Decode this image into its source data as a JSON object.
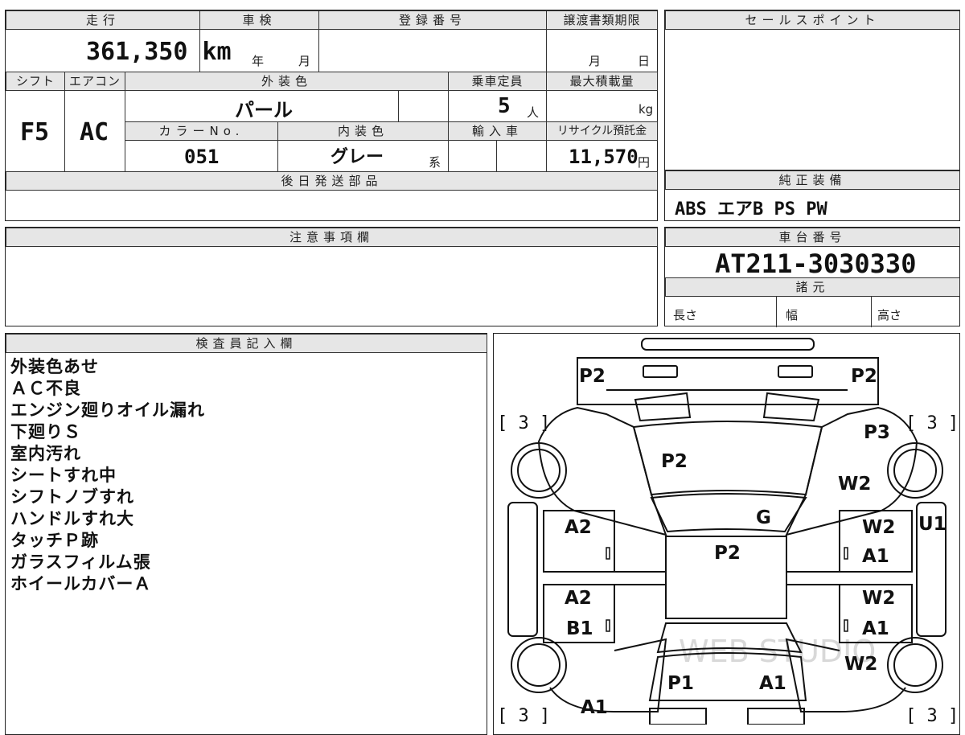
{
  "top_block": {
    "mileage_label": "走行",
    "mileage_value": "361,350 km",
    "inspection_label": "車検",
    "inspection_year": "年",
    "inspection_month": "月",
    "registration_label": "登録番号",
    "deadline_label": "譲渡書類期限",
    "deadline_month": "月",
    "deadline_day": "日",
    "shift_label": "シフト",
    "shift_value": "F5",
    "ac_label": "エアコン",
    "ac_value": "AC",
    "exterior_label": "外装色",
    "exterior_value": "パール",
    "capacity_label": "乗車定員",
    "capacity_value": "5",
    "capacity_unit": "人",
    "maxload_label": "最大積載量",
    "maxload_unit": "kg",
    "color_no_label": "カラーNo.",
    "color_no_value": "051",
    "interior_label": "内装色",
    "interior_value": "グレー",
    "interior_suffix": "系",
    "import_label": "輸入車",
    "recycle_label": "リサイクル預託金",
    "recycle_value": "11,570",
    "recycle_unit": "円",
    "later_parts_label": "後日発送部品"
  },
  "sales_point": {
    "label": "セールスポイント"
  },
  "genuine_equipment": {
    "label": "純正装備",
    "value": "ABS エアB PS PW"
  },
  "caution": {
    "label": "注意事項欄"
  },
  "chassis": {
    "label": "車台番号",
    "value": "AT211-3030330",
    "spec_label": "諸元",
    "length_label": "長さ",
    "width_label": "幅",
    "height_label": "高さ"
  },
  "inspector": {
    "label": "検査員記入欄",
    "notes": [
      "外装色あせ",
      "ＡＣ不良",
      "エンジン廻りオイル漏れ",
      "下廻りＳ",
      "室内汚れ",
      "シートすれ中",
      "シフトノブすれ",
      "ハンドルすれ大",
      "タッチＰ跡",
      "ガラスフィルム張",
      "ホイールカバーＡ"
    ]
  },
  "diagram": {
    "marks": {
      "front_left": "P2",
      "front_right": "P2",
      "hood": "P2",
      "front_right_fender": "P3",
      "right_fender_w": "W2",
      "windshield": "G",
      "roof": "P2",
      "left_front_door": "A2",
      "right_front_door_a": "W2",
      "right_front_door_b": "A1",
      "left_rear_door_a": "A2",
      "left_rear_door_b": "B1",
      "right_rear_door_a": "W2",
      "right_rear_door_b": "A1",
      "right_rear_fender": "W2",
      "right_side": "U1",
      "trunk_left": "P1",
      "trunk_right": "A1",
      "rear_left": "A1"
    },
    "brackets": {
      "front_left": "[ 3 ]",
      "front_right": "[ 3 ]",
      "rear_left": "[ 3 ]",
      "rear_right": "[ 3 ]"
    },
    "watermark": "WEB STUDIO"
  }
}
